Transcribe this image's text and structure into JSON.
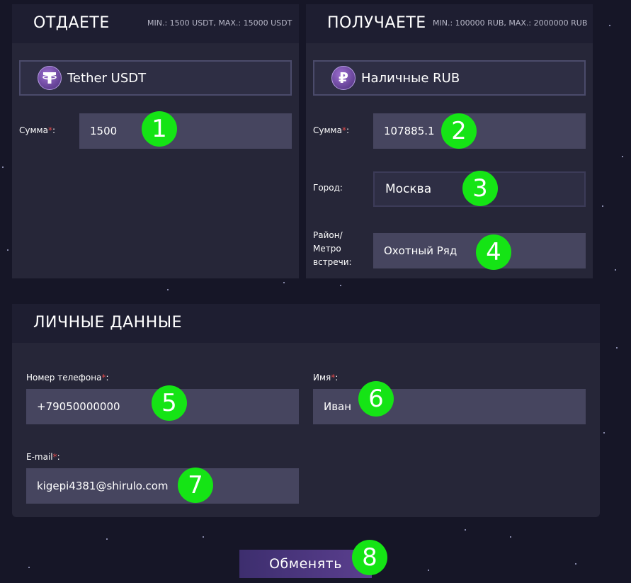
{
  "give": {
    "title": "ОТДАЕТЕ",
    "limits": "MIN.: 1500 USDT, MAX.: 15000 USDT",
    "currency": {
      "icon": "tether-icon",
      "label": "Tether USDT"
    },
    "amount": {
      "label": "Сумма",
      "required_mark": "*",
      "suffix": ":",
      "value": "1500"
    }
  },
  "receive": {
    "title": "ПОЛУЧАЕТЕ",
    "limits": "MIN.: 100000 RUB, MAX.: 2000000 RUB",
    "currency": {
      "icon": "ruble-icon",
      "label": "Наличные RUB"
    },
    "amount": {
      "label": "Сумма",
      "required_mark": "*",
      "suffix": ":",
      "value": "107885.1"
    },
    "city": {
      "label": "Город:",
      "value": "Москва"
    },
    "district": {
      "label_line1": "Район/",
      "label_line2": "Метро",
      "label_line3": "встречи:",
      "value": "Охотный Ряд"
    }
  },
  "personal": {
    "title": "ЛИЧНЫЕ ДАННЫЕ",
    "phone": {
      "label": "Номер телефона",
      "required_mark": "*",
      "suffix": ":",
      "value": "+79050000000"
    },
    "name": {
      "label": "Имя",
      "required_mark": "*",
      "suffix": ":",
      "value": "Иван"
    },
    "email": {
      "label": "E-mail",
      "required_mark": "*",
      "suffix": ":",
      "value": "kigepi4381@shirulo.com"
    }
  },
  "submit_label": "Обменять",
  "badges": [
    "1",
    "2",
    "3",
    "4",
    "5",
    "6",
    "7",
    "8"
  ],
  "colors": {
    "badge": "#15e415",
    "background": "#161627",
    "panel": "#262638",
    "required": "#e04a4a"
  }
}
